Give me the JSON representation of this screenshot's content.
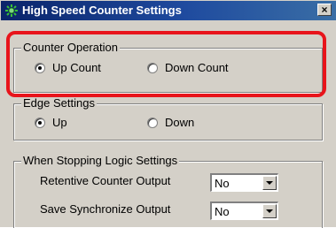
{
  "window": {
    "title": "High Speed Counter Settings",
    "close_glyph": "×"
  },
  "counter_operation": {
    "title": "Counter Operation",
    "options": [
      {
        "label": "Up Count",
        "checked": true
      },
      {
        "label": "Down Count",
        "checked": false
      }
    ]
  },
  "edge_settings": {
    "title": "Edge Settings",
    "options": [
      {
        "label": "Up",
        "checked": true
      },
      {
        "label": "Down",
        "checked": false
      }
    ]
  },
  "stopping_logic": {
    "title": "When Stopping Logic Settings",
    "fields": [
      {
        "label": "Retentive Counter Output",
        "value": "No"
      },
      {
        "label": "Save Synchronize Output",
        "value": "No"
      }
    ]
  },
  "highlight_color": "#e8141b"
}
